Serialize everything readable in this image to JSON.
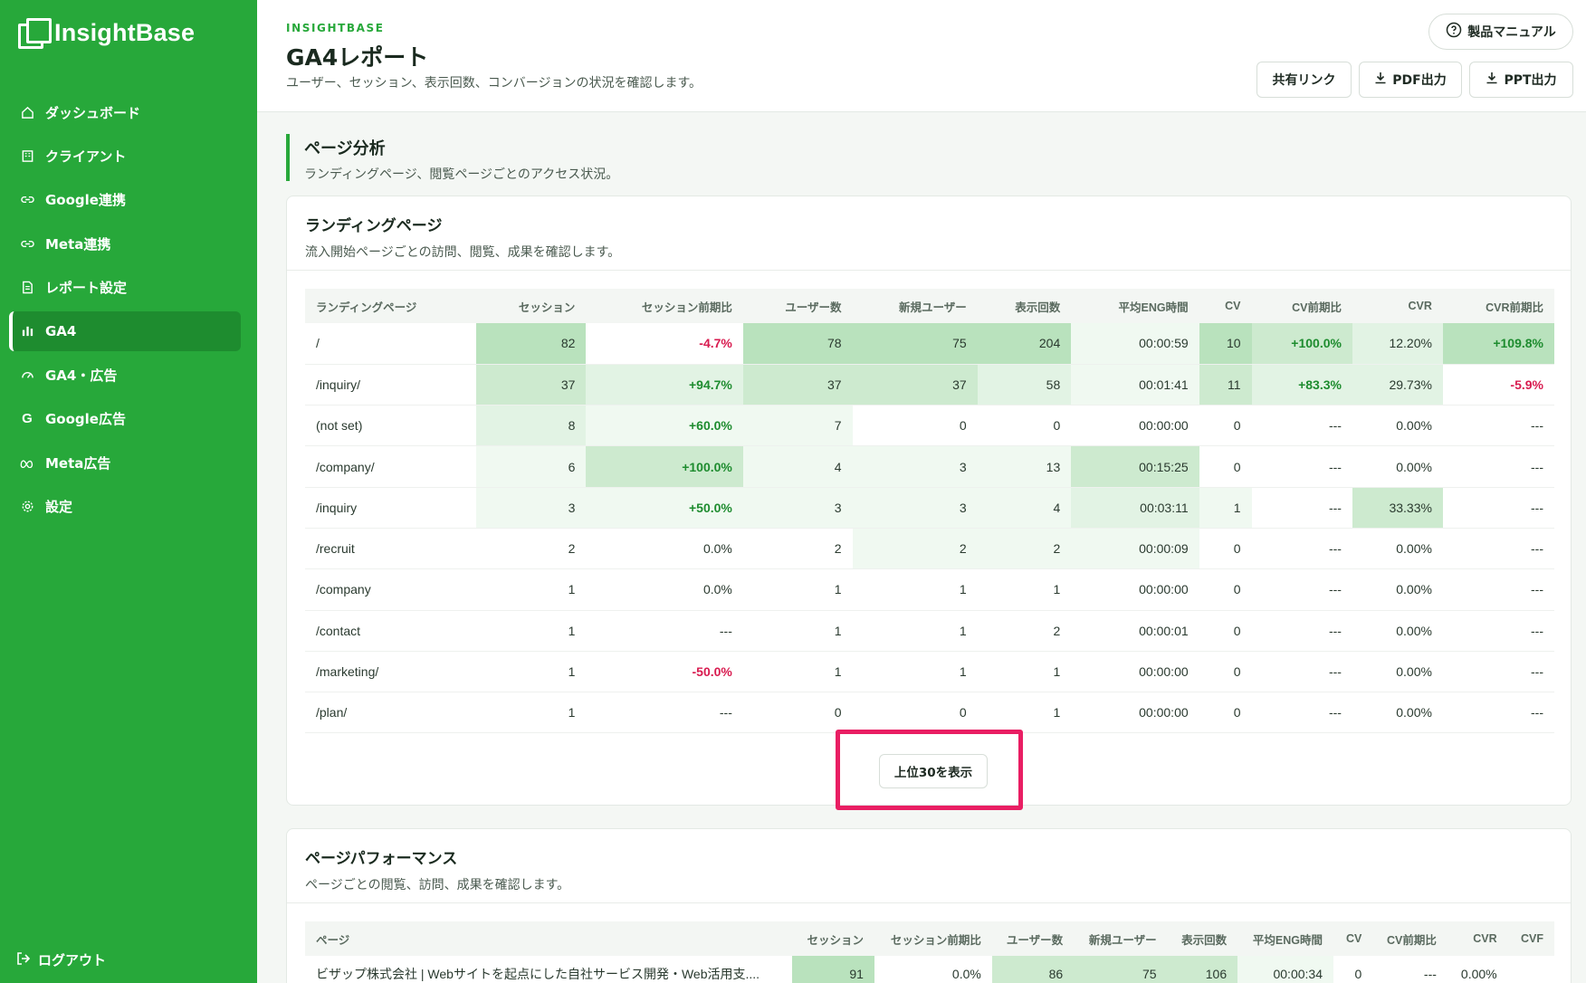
{
  "sidebar": {
    "logo": "InsightBase",
    "items": [
      {
        "label": "ダッシュボード",
        "icon": "home-icon"
      },
      {
        "label": "クライアント",
        "icon": "building-icon"
      },
      {
        "label": "Google連携",
        "icon": "link-icon"
      },
      {
        "label": "Meta連携",
        "icon": "link-icon"
      },
      {
        "label": "レポート設定",
        "icon": "document-icon"
      },
      {
        "label": "GA4",
        "icon": "bar-chart-icon"
      },
      {
        "label": "GA4・広告",
        "icon": "gauge-icon"
      },
      {
        "label": "Google広告",
        "icon": "google-icon"
      },
      {
        "label": "Meta広告",
        "icon": "meta-icon"
      },
      {
        "label": "設定",
        "icon": "gear-icon"
      }
    ],
    "active_index": 5,
    "logout": "ログアウト"
  },
  "header": {
    "brand": "INSIGHTBASE",
    "title": "GA4レポート",
    "subtitle": "ユーザー、セッション、表示回数、コンバージョンの状況を確認します。",
    "manual_label": "製品マニュアル",
    "share_label": "共有リンク",
    "pdf_label": "PDF出力",
    "ppt_label": "PPT出力"
  },
  "section": {
    "title": "ページ分析",
    "subtitle": "ランディングページ、閲覧ページごとのアクセス状況。"
  },
  "landing": {
    "title": "ランディングページ",
    "subtitle": "流入開始ページごとの訪問、閲覧、成果を確認します。",
    "columns": [
      "ランディングページ",
      "セッション",
      "セッション前期比",
      "ユーザー数",
      "新規ユーザー",
      "表示回数",
      "平均ENG時間",
      "CV",
      "CV前期比",
      "CVR",
      "CVR前期比"
    ],
    "rows": [
      [
        "/",
        "82",
        "-4.7%",
        "78",
        "75",
        "204",
        "00:00:59",
        "10",
        "+100.0%",
        "12.20%",
        "+109.8%"
      ],
      [
        "/inquiry/",
        "37",
        "+94.7%",
        "37",
        "37",
        "58",
        "00:01:41",
        "11",
        "+83.3%",
        "29.73%",
        "-5.9%"
      ],
      [
        "(not set)",
        "8",
        "+60.0%",
        "7",
        "0",
        "0",
        "00:00:00",
        "0",
        "---",
        "0.00%",
        "---"
      ],
      [
        "/company/",
        "6",
        "+100.0%",
        "4",
        "3",
        "13",
        "00:15:25",
        "0",
        "---",
        "0.00%",
        "---"
      ],
      [
        "/inquiry",
        "3",
        "+50.0%",
        "3",
        "3",
        "4",
        "00:03:11",
        "1",
        "---",
        "33.33%",
        "---"
      ],
      [
        "/recruit",
        "2",
        "0.0%",
        "2",
        "2",
        "2",
        "00:00:09",
        "0",
        "---",
        "0.00%",
        "---"
      ],
      [
        "/company",
        "1",
        "0.0%",
        "1",
        "1",
        "1",
        "00:00:00",
        "0",
        "---",
        "0.00%",
        "---"
      ],
      [
        "/contact",
        "1",
        "---",
        "1",
        "1",
        "2",
        "00:00:01",
        "0",
        "---",
        "0.00%",
        "---"
      ],
      [
        "/marketing/",
        "1",
        "-50.0%",
        "1",
        "1",
        "1",
        "00:00:00",
        "0",
        "---",
        "0.00%",
        "---"
      ],
      [
        "/plan/",
        "1",
        "---",
        "0",
        "0",
        "1",
        "00:00:00",
        "0",
        "---",
        "0.00%",
        "---"
      ]
    ],
    "heat": [
      [
        0,
        4,
        0,
        4,
        4,
        4,
        1,
        4,
        3,
        2,
        4
      ],
      [
        0,
        3,
        2,
        3,
        3,
        2,
        1,
        3,
        2,
        2,
        0
      ],
      [
        0,
        2,
        1,
        1,
        0,
        0,
        0,
        0,
        0,
        0,
        0
      ],
      [
        0,
        1,
        3,
        1,
        1,
        1,
        3,
        0,
        0,
        0,
        0
      ],
      [
        0,
        1,
        1,
        1,
        1,
        1,
        2,
        1,
        0,
        3,
        0
      ],
      [
        0,
        0,
        0,
        0,
        1,
        1,
        1,
        0,
        0,
        0,
        0
      ],
      [
        0,
        0,
        0,
        0,
        0,
        0,
        0,
        0,
        0,
        0,
        0
      ],
      [
        0,
        0,
        0,
        0,
        0,
        0,
        0,
        0,
        0,
        0,
        0
      ],
      [
        0,
        0,
        0,
        0,
        0,
        0,
        0,
        0,
        0,
        0,
        0
      ],
      [
        0,
        0,
        0,
        0,
        0,
        0,
        0,
        0,
        0,
        0,
        0
      ]
    ],
    "more_label": "上位30を表示"
  },
  "performance": {
    "title": "ページパフォーマンス",
    "subtitle": "ページごとの閲覧、訪問、成果を確認します。",
    "columns": [
      "ページ",
      "セッション",
      "セッション前期比",
      "ユーザー数",
      "新規ユーザー",
      "表示回数",
      "平均ENG時間",
      "CV",
      "CV前期比",
      "CVR",
      "CVF"
    ],
    "rows": [
      [
        "ビザップ株式会社 | Webサイトを起点にした自社サービス開発・Web活用支....",
        "91",
        "0.0%",
        "86",
        "75",
        "106",
        "00:00:34",
        "0",
        "---",
        "0.00%",
        ""
      ]
    ],
    "heat": [
      [
        0,
        4,
        0,
        3,
        3,
        3,
        1,
        0,
        0,
        0,
        0
      ]
    ]
  }
}
